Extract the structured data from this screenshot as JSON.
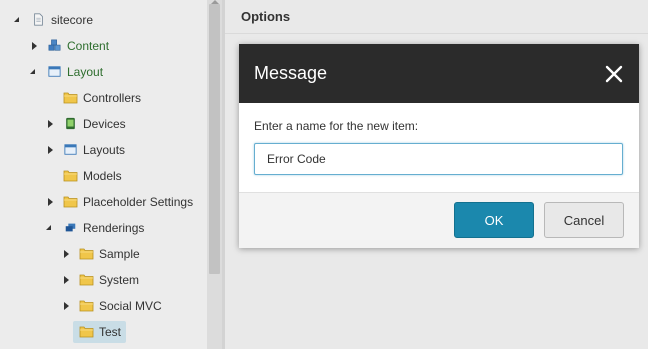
{
  "tree": {
    "items": [
      {
        "label": "sitecore",
        "icon": "document-icon",
        "state": "expanded"
      },
      {
        "label": "Content",
        "icon": "content-cubes-icon",
        "state": "collapsed"
      },
      {
        "label": "Layout",
        "icon": "layout-window-icon",
        "state": "expanded"
      },
      {
        "label": "Controllers",
        "icon": "folder-icon",
        "state": "leaf"
      },
      {
        "label": "Devices",
        "icon": "device-icon",
        "state": "collapsed"
      },
      {
        "label": "Layouts",
        "icon": "layout-window-icon",
        "state": "collapsed"
      },
      {
        "label": "Models",
        "icon": "folder-icon",
        "state": "leaf"
      },
      {
        "label": "Placeholder Settings",
        "icon": "folder-icon",
        "state": "collapsed"
      },
      {
        "label": "Renderings",
        "icon": "renderings-icon",
        "state": "expanded"
      },
      {
        "label": "Sample",
        "icon": "folder-icon",
        "state": "collapsed"
      },
      {
        "label": "System",
        "icon": "folder-icon",
        "state": "collapsed"
      },
      {
        "label": "Social MVC",
        "icon": "folder-icon",
        "state": "collapsed"
      },
      {
        "label": "Test",
        "icon": "folder-icon",
        "state": "leaf",
        "selected": true
      }
    ]
  },
  "pane": {
    "title": "Options"
  },
  "dialog": {
    "title": "Message",
    "prompt": "Enter a name for the new item:",
    "input_value": "Error Code",
    "ok_label": "OK",
    "cancel_label": "Cancel"
  },
  "colors": {
    "header": "#2b2b2b",
    "ok": "#1b88ad",
    "folder": "#f0c64a",
    "selected": "#c9dde6"
  }
}
